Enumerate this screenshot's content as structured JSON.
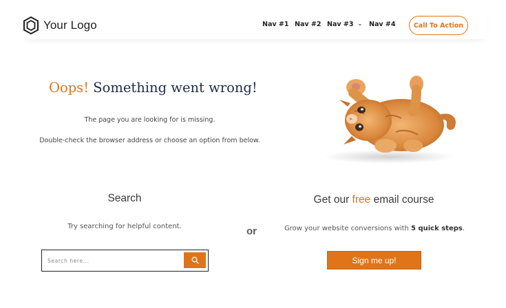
{
  "header": {
    "logo_text": "Your Logo",
    "nav": [
      "Nav #1",
      "Nav #2",
      "Nav #3",
      "Nav #4"
    ],
    "cta_label": "Call To Action"
  },
  "error": {
    "oops": "Oops!",
    "headline_rest": "Something went wrong!",
    "missing_text": "The page you are looking for is missing.",
    "hint_text": "Double-check the browser address or choose an option from below."
  },
  "search": {
    "title": "Search",
    "description": "Try searching for helpful content.",
    "placeholder": "Search here..."
  },
  "separator": "or",
  "course": {
    "title_pre": "Get our ",
    "title_free": "free",
    "title_post": " email course",
    "desc_pre": "Grow your website conversions with ",
    "desc_bold": "5 quick steps",
    "desc_post": ".",
    "button_label": "Sign me up!"
  },
  "colors": {
    "accent": "#e07418",
    "headline_dark": "#1e2a4a"
  },
  "icons": [
    "hexagon-logo-icon",
    "chevron-down-icon",
    "search-icon",
    "kitten-image"
  ]
}
